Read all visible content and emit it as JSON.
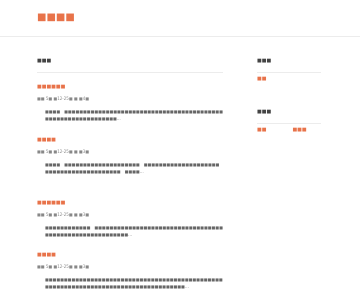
{
  "header": {
    "site_title": "■■■■"
  },
  "main": {
    "heading": "■■■",
    "posts": [
      {
        "title": "■■■■■■",
        "meta": "■■ 5■ ■12-25■ ■ ■4■",
        "excerpt": "■■■■　■■■■■■■■■■■■■■■■■■■■■■■■■■■■■■■■■■■■■■■■■■■■■■■■■■■■■■■■■■■■■…"
      },
      {
        "title": "■■■■",
        "meta": "■■ 5■ ■12-25■ ■ ■3■",
        "excerpt": "■■■■　■■■■■■■■■■■■■■■■■■■■　■■■■■■■■■■■■■■■■■■■■　■■■■■■■■■■■■■■■■■■■■　■■■■…"
      },
      {
        "title": "■■■■■■",
        "meta": "■■ 5■ ■12-25■ ■ ■3■",
        "excerpt": "■■■■■■■■■■■■　■■■■■■■■■■■■■■■■■■■■■■■■■■■■■■■■■■■■■■■■■■■■■■■■■■■■■■■■…"
      },
      {
        "title": "■■■■",
        "meta": "■■ 5■ ■12-25■ ■ ■3■",
        "excerpt": "■■■■■■■■■■■■■■■■■■■■■■■■■■■■■■■■■■■■■■■■■■■■■■■■■■■■■■■■■■■■■■■■■■■■■■■■■■■■■■■■■■■■…"
      }
    ]
  },
  "sidebar": {
    "widgets": [
      {
        "title": "■■■",
        "links": [
          "■■"
        ]
      },
      {
        "title": "■■■",
        "links": [
          "■■",
          "■■■"
        ]
      }
    ]
  },
  "colors": {
    "accent": "#e8734a",
    "divider": "#ececec"
  }
}
